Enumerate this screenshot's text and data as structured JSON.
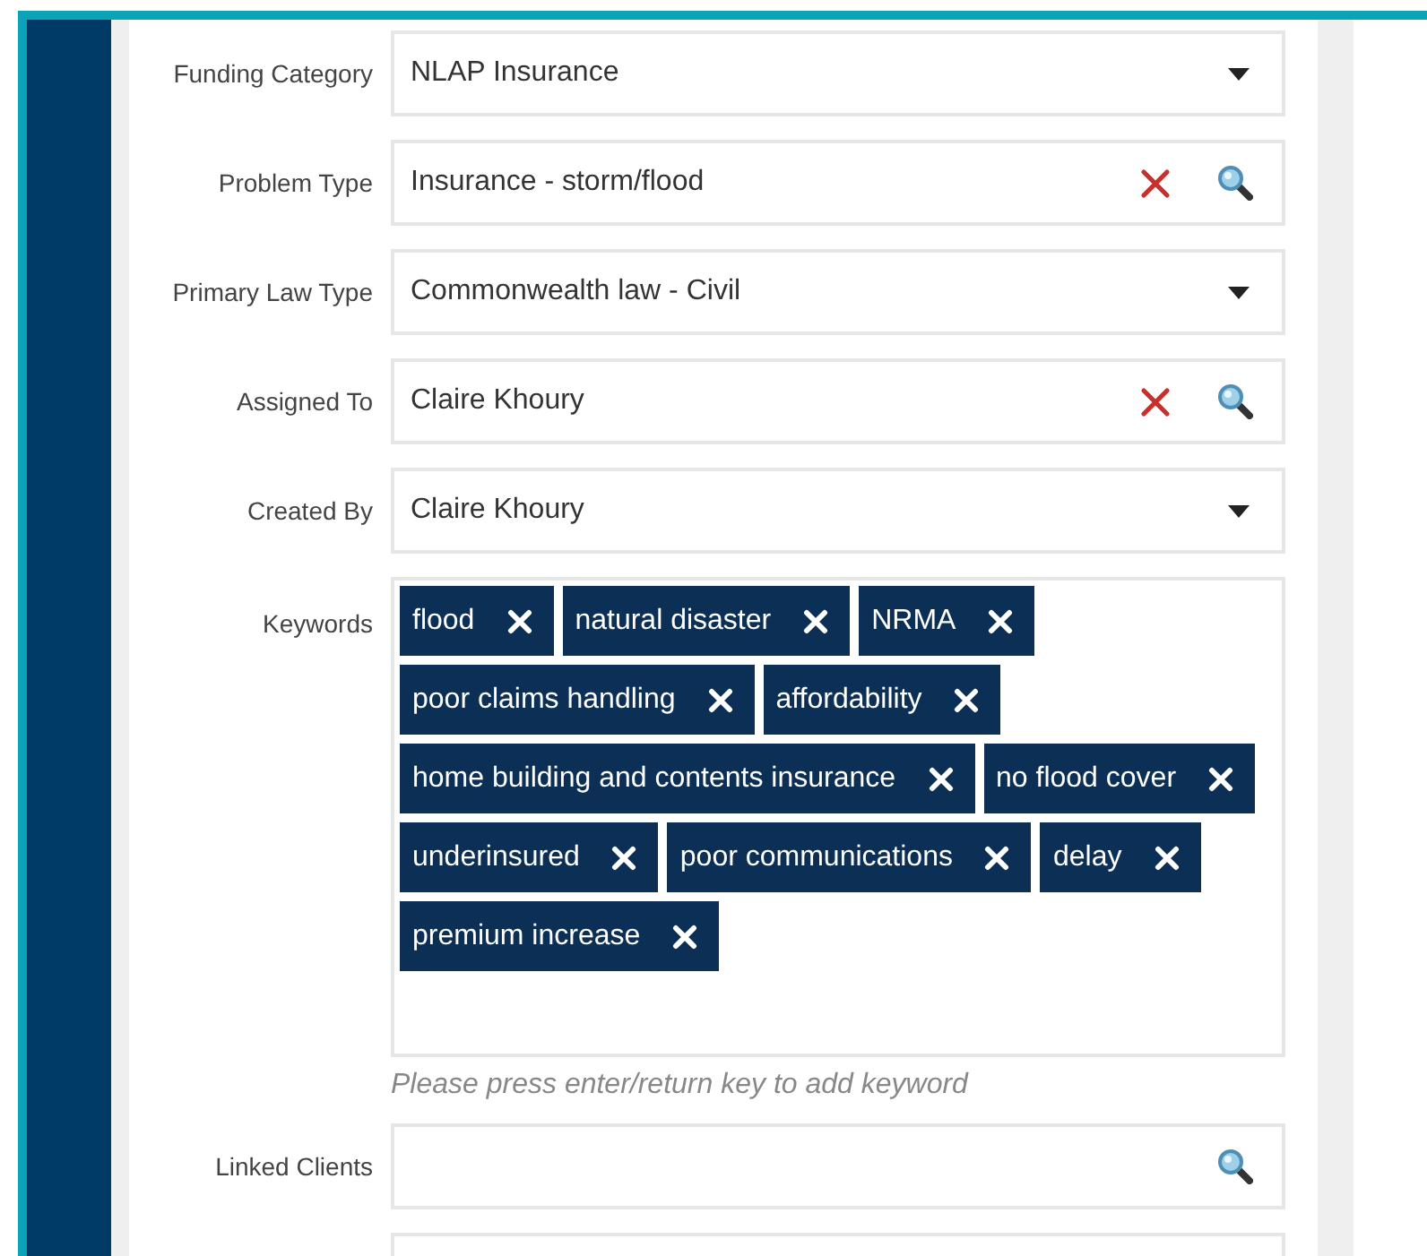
{
  "fields": [
    {
      "label": "Funding Category",
      "kind": "dropdown",
      "value": "NLAP Insurance"
    },
    {
      "label": "Problem Type",
      "kind": "lookup",
      "value": "Insurance - storm/flood",
      "clearable": true
    },
    {
      "label": "Primary Law Type",
      "kind": "dropdown",
      "value": "Commonwealth law - Civil"
    },
    {
      "label": "Assigned To",
      "kind": "lookup",
      "value": "Claire Khoury",
      "clearable": true
    },
    {
      "label": "Created By",
      "kind": "dropdown",
      "value": "Claire Khoury"
    },
    {
      "label": "Keywords",
      "kind": "tags",
      "tags": [
        "flood",
        "natural disaster",
        "NRMA",
        "poor claims handling",
        "affordability",
        "home building and contents insurance",
        "no flood cover",
        "underinsured",
        "poor communications",
        "delay",
        "premium increase"
      ],
      "hint": "Please press enter/return key to add keyword"
    },
    {
      "label": "Linked Clients",
      "kind": "lookup",
      "clearable": false
    },
    {
      "kind": "text"
    }
  ]
}
